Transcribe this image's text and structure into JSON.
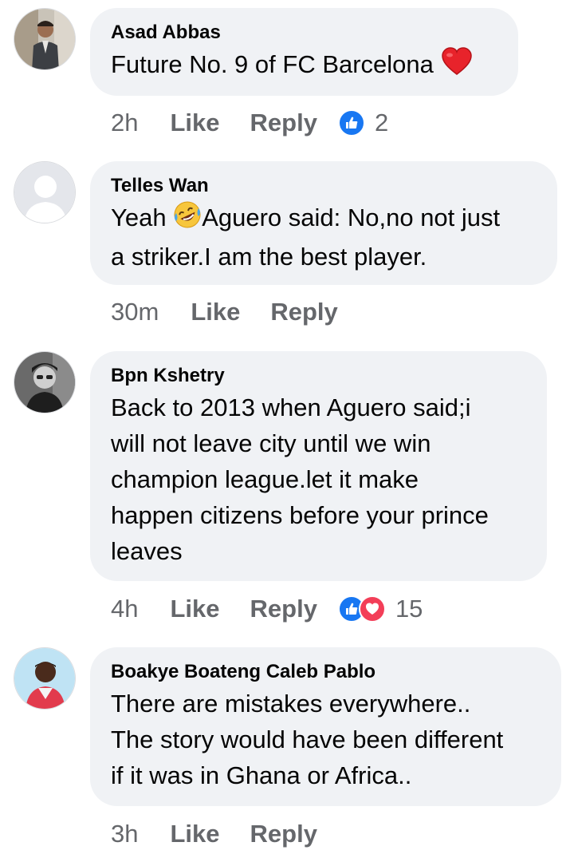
{
  "colors": {
    "bubble_bg": "#f0f2f5",
    "meta_text": "#65676b",
    "like_blue": "#1877f2",
    "love_red": "#f33e58",
    "heart_red": "#e8232b",
    "emoji_yellow": "#f7c63c"
  },
  "comments": [
    {
      "author": "Asad Abbas",
      "lines": [
        "Future No. 9 of FC Barcelona"
      ],
      "trailing_emoji": "red-heart",
      "time": "2h",
      "like_label": "Like",
      "reply_label": "Reply",
      "reactions": [
        "like"
      ],
      "reaction_count": "2"
    },
    {
      "author": "Telles Wan",
      "lines": [
        "Yeah",
        "Aguero said: No,no not just",
        "a striker.I am the best player."
      ],
      "inline_emoji": "rolling-laughing",
      "time": "30m",
      "like_label": "Like",
      "reply_label": "Reply"
    },
    {
      "author": "Bpn Kshetry",
      "lines": [
        "Back to 2013 when Aguero said;i",
        "will not leave city until we win",
        "champion league.let it make",
        "happen citizens before your prince",
        "leaves"
      ],
      "time": "4h",
      "like_label": "Like",
      "reply_label": "Reply",
      "reactions": [
        "like",
        "love"
      ],
      "reaction_count": "15"
    },
    {
      "author": "Boakye Boateng Caleb Pablo",
      "lines": [
        "There are mistakes everywhere..",
        "The story would have been different",
        "if it was in Ghana or Africa.."
      ],
      "time": "3h",
      "like_label": "Like",
      "reply_label": "Reply"
    }
  ]
}
